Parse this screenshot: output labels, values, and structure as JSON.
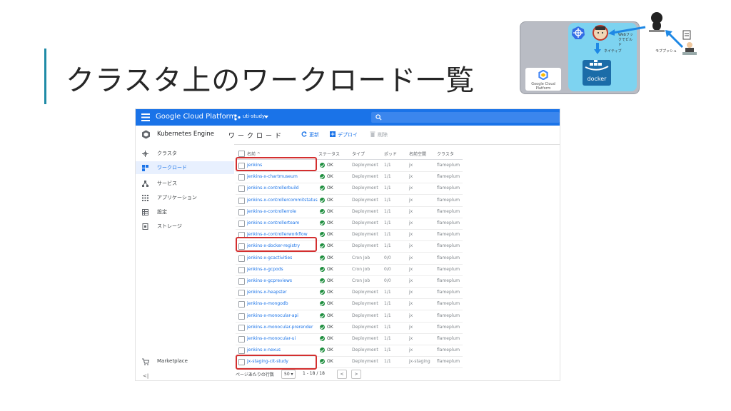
{
  "slide": {
    "title": "クラスタ上のワークロード一覧"
  },
  "diagram": {
    "gcp_label": "Google Cloud Platform",
    "docker_label": "docker",
    "push_label": "ネイティブ",
    "hook_label": "Webフックでビルド",
    "push2_label": "モブプッシュ"
  },
  "console": {
    "brand": "Google Cloud Platform",
    "project": "uti-study",
    "product": "Kubernetes Engine",
    "page_title": "ワークロード",
    "toolbar": {
      "refresh": "更新",
      "deploy": "デプロイ",
      "delete": "削除"
    },
    "nav": [
      {
        "label": "クラスタ",
        "icon": "cluster-icon"
      },
      {
        "label": "ワークロード",
        "icon": "workload-icon",
        "active": true
      },
      {
        "label": "サービス",
        "icon": "service-icon"
      },
      {
        "label": "アプリケーション",
        "icon": "apps-icon"
      },
      {
        "label": "設定",
        "icon": "config-icon"
      },
      {
        "label": "ストレージ",
        "icon": "storage-icon"
      }
    ],
    "marketplace": "Marketplace",
    "collapse": "<|",
    "table": {
      "headers": {
        "name": "名前 ^",
        "status": "ステータス",
        "type": "タイプ",
        "pods": "ポッド",
        "namespace": "名前空間",
        "cluster": "クラスタ"
      },
      "rows": [
        {
          "name": "jenkins",
          "status": "OK",
          "type": "Deployment",
          "pods": "1/1",
          "ns": "jx",
          "cluster": "flameplum"
        },
        {
          "name": "jenkins-x-chartmuseum",
          "status": "OK",
          "type": "Deployment",
          "pods": "1/1",
          "ns": "jx",
          "cluster": "flameplum"
        },
        {
          "name": "jenkins-x-controllerbuild",
          "status": "OK",
          "type": "Deployment",
          "pods": "1/1",
          "ns": "jx",
          "cluster": "flameplum"
        },
        {
          "name": "jenkins-x-controllercommitstatus",
          "status": "OK",
          "type": "Deployment",
          "pods": "1/1",
          "ns": "jx",
          "cluster": "flameplum"
        },
        {
          "name": "jenkins-x-controllerrole",
          "status": "OK",
          "type": "Deployment",
          "pods": "1/1",
          "ns": "jx",
          "cluster": "flameplum"
        },
        {
          "name": "jenkins-x-controllerteam",
          "status": "OK",
          "type": "Deployment",
          "pods": "1/1",
          "ns": "jx",
          "cluster": "flameplum"
        },
        {
          "name": "jenkins-x-controllerworkflow",
          "status": "OK",
          "type": "Deployment",
          "pods": "1/1",
          "ns": "jx",
          "cluster": "flameplum"
        },
        {
          "name": "jenkins-x-docker-registry",
          "status": "OK",
          "type": "Deployment",
          "pods": "1/1",
          "ns": "jx",
          "cluster": "flameplum"
        },
        {
          "name": "jenkins-x-gcactivities",
          "status": "OK",
          "type": "Cron Job",
          "pods": "0/0",
          "ns": "jx",
          "cluster": "flameplum"
        },
        {
          "name": "jenkins-x-gcpods",
          "status": "OK",
          "type": "Cron Job",
          "pods": "0/0",
          "ns": "jx",
          "cluster": "flameplum"
        },
        {
          "name": "jenkins-x-gcpreviews",
          "status": "OK",
          "type": "Cron Job",
          "pods": "0/0",
          "ns": "jx",
          "cluster": "flameplum"
        },
        {
          "name": "jenkins-x-heapster",
          "status": "OK",
          "type": "Deployment",
          "pods": "1/1",
          "ns": "jx",
          "cluster": "flameplum"
        },
        {
          "name": "jenkins-x-mongodb",
          "status": "OK",
          "type": "Deployment",
          "pods": "1/1",
          "ns": "jx",
          "cluster": "flameplum"
        },
        {
          "name": "jenkins-x-monocular-api",
          "status": "OK",
          "type": "Deployment",
          "pods": "1/1",
          "ns": "jx",
          "cluster": "flameplum"
        },
        {
          "name": "jenkins-x-monocular-prerender",
          "status": "OK",
          "type": "Deployment",
          "pods": "1/1",
          "ns": "jx",
          "cluster": "flameplum"
        },
        {
          "name": "jenkins-x-monocular-ui",
          "status": "OK",
          "type": "Deployment",
          "pods": "1/1",
          "ns": "jx",
          "cluster": "flameplum"
        },
        {
          "name": "jenkins-x-nexus",
          "status": "OK",
          "type": "Deployment",
          "pods": "1/1",
          "ns": "jx",
          "cluster": "flameplum"
        },
        {
          "name": "jx-staging-cit-study",
          "status": "OK",
          "type": "Deployment",
          "pods": "1/1",
          "ns": "jx-staging",
          "cluster": "flameplum"
        }
      ]
    },
    "pager": {
      "rows_label": "ページあたりの行数",
      "rows_value": "50 ▾",
      "range": "1 - 18 / 18",
      "prev": "<",
      "next": ">"
    }
  }
}
